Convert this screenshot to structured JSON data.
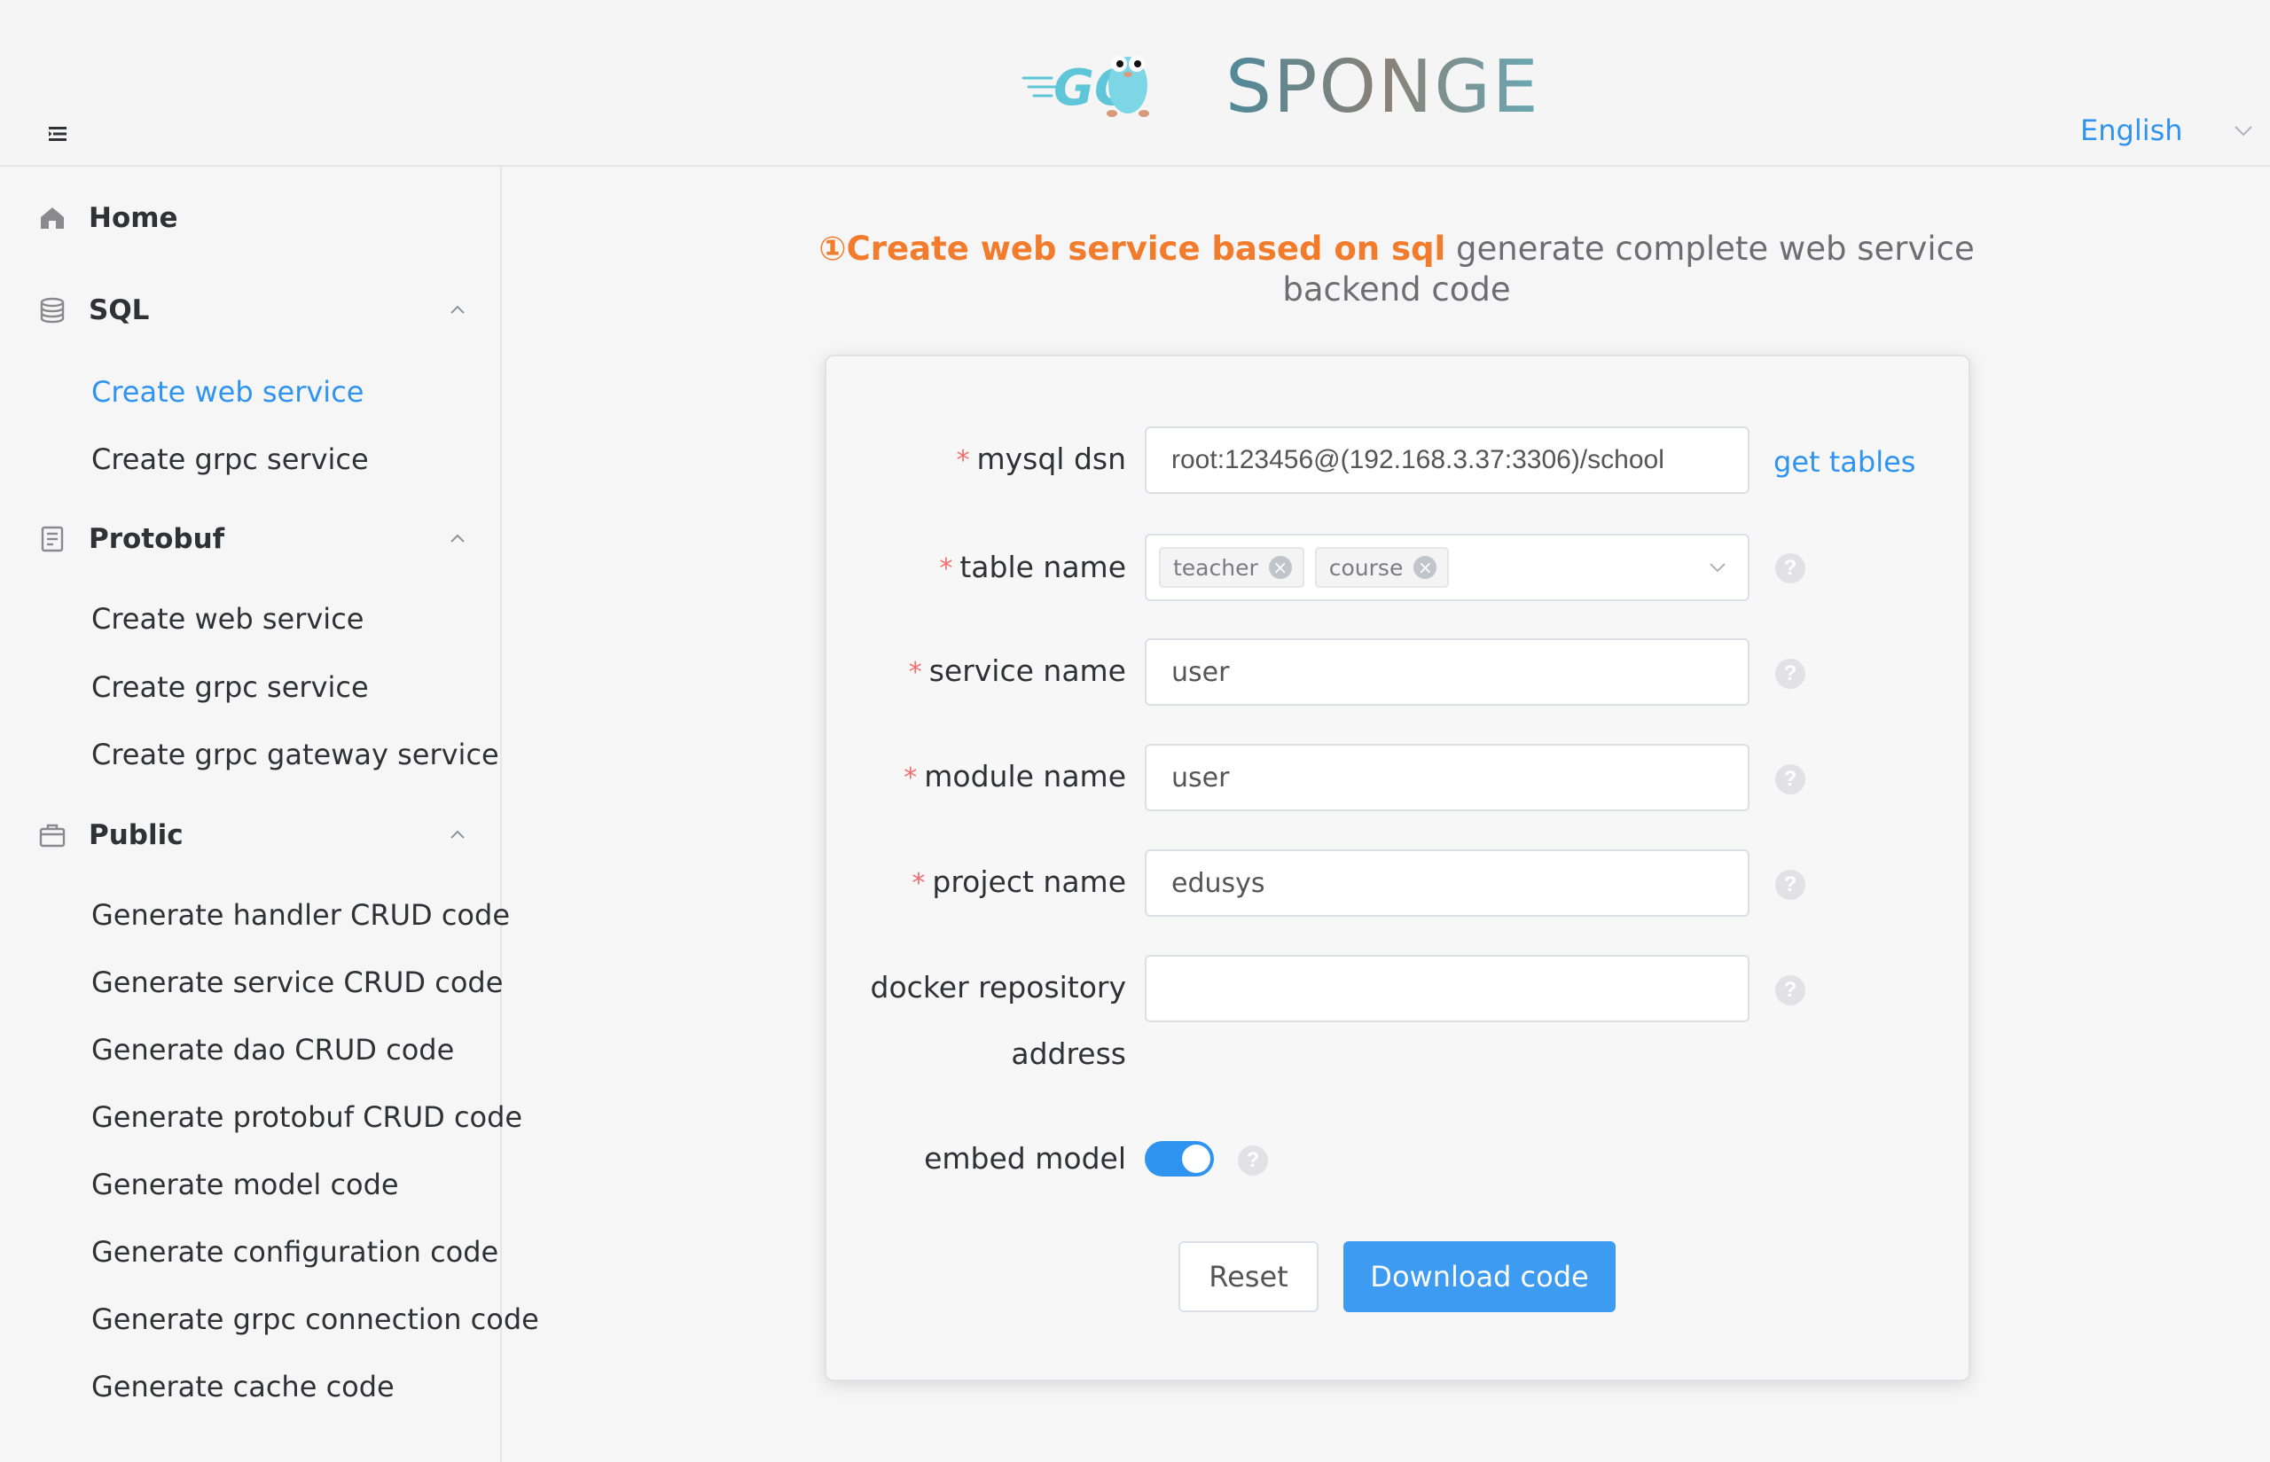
{
  "header": {
    "logo_go": "GO",
    "logo_text": "SPONGE",
    "language": "English"
  },
  "sidebar": {
    "home": "Home",
    "groups": [
      {
        "label": "SQL",
        "items": [
          "Create web service",
          "Create grpc service"
        ]
      },
      {
        "label": "Protobuf",
        "items": [
          "Create web service",
          "Create grpc service",
          "Create grpc gateway service"
        ]
      },
      {
        "label": "Public",
        "items": [
          "Generate handler CRUD code",
          "Generate service CRUD code",
          "Generate dao CRUD code",
          "Generate protobuf CRUD code",
          "Generate model code",
          "Generate configuration code",
          "Generate grpc connection code",
          "Generate cache code"
        ]
      }
    ],
    "active_item": "SQL / Create web service"
  },
  "main": {
    "headline_highlight": "①Create web service based on sql",
    "headline_rest_1": " generate complete web service",
    "headline_rest_2": "backend code"
  },
  "form": {
    "mysql_dsn_label": "mysql dsn",
    "mysql_dsn_value": "root:123456@(192.168.3.37:3306)/school",
    "get_tables": "get tables",
    "table_name_label": "table name",
    "table_tags": [
      "teacher",
      "course"
    ],
    "service_name_label": "service name",
    "service_name_value": "user",
    "module_name_label": "module name",
    "module_name_value": "user",
    "project_name_label": "project name",
    "project_name_value": "edusys",
    "docker_label_1": "docker repository",
    "docker_label_2": "address",
    "docker_value": "",
    "embed_model_label": "embed model",
    "embed_model_on": true,
    "help_glyph": "?",
    "reset": "Reset",
    "download": "Download code"
  },
  "colors": {
    "accent": "#2f93f0",
    "highlight": "#f37b2c",
    "required": "#f56c6c"
  }
}
